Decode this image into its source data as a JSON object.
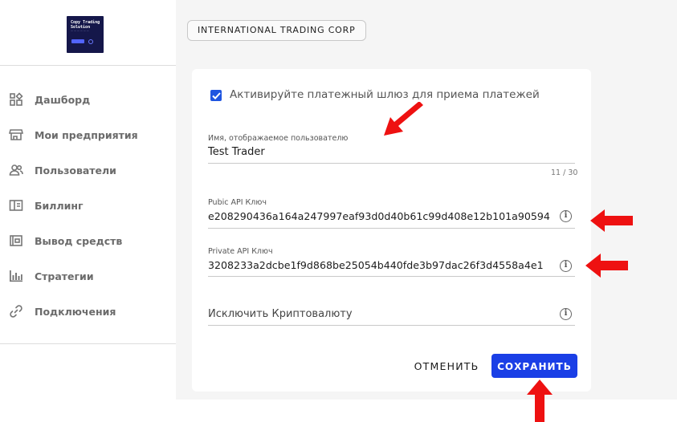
{
  "logo": {
    "line1": "Copy Trading",
    "line2": "Solution"
  },
  "sidebar": {
    "items": [
      {
        "label": "Дашборд",
        "icon": "dashboard-icon"
      },
      {
        "label": "Мои предприятия",
        "icon": "store-icon"
      },
      {
        "label": "Пользователи",
        "icon": "users-icon"
      },
      {
        "label": "Биллинг",
        "icon": "billing-icon"
      },
      {
        "label": "Вывод средств",
        "icon": "wallet-icon"
      },
      {
        "label": "Стратегии",
        "icon": "strategies-icon"
      },
      {
        "label": "Подключения",
        "icon": "link-icon"
      }
    ]
  },
  "company_chip": "INTERNATIONAL TRADING CORP",
  "form": {
    "activate_checkbox": {
      "label": "Активируйте платежный шлюз для приема платежей",
      "checked": true
    },
    "display_name": {
      "label": "Имя, отображаемое пользователю",
      "value": "Test Trader",
      "counter": "11 / 30"
    },
    "public_key": {
      "label": "Pubic API Ключ",
      "value": "e208290436a164a247997eaf93d0d40b61c99d408e12b101a90594"
    },
    "private_key": {
      "label": "Private API Ключ",
      "value": "3208233a2dcbe1f9d868be25054b440fde3b97dac26f3d4558a4e1"
    },
    "exclude_crypto": {
      "placeholder": "Исключить Криптовалюту"
    }
  },
  "buttons": {
    "cancel": "ОТМЕНИТЬ",
    "save": "СОХРАНИТЬ"
  },
  "colors": {
    "accent": "#1a3fe6",
    "annotation_arrow": "#ee1111",
    "main_background": "#f5f5f5"
  },
  "icons": {
    "info": "i"
  }
}
